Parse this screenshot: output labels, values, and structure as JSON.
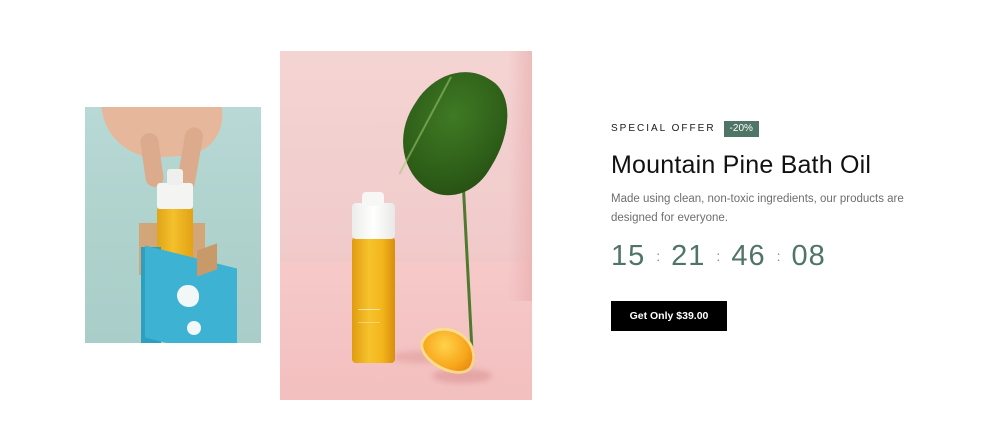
{
  "promo": {
    "offer_label": "SPECIAL OFFER",
    "discount_badge": "-20%",
    "title": "Mountain Pine Bath Oil",
    "description": "Made using clean, non-toxic ingredients, our products are designed for everyone.",
    "countdown": {
      "hours_or_days": "15",
      "hours": "21",
      "minutes": "46",
      "seconds": "08",
      "separator": ":"
    },
    "cta_label": "Get Only $39.00"
  },
  "images": {
    "secondary": "product-photo-hand-bottle-box",
    "primary": "product-photo-bottle-leaf-orange"
  },
  "colors": {
    "accent": "#4f7566",
    "button_bg": "#000000",
    "button_text": "#ffffff",
    "title_text": "#111111",
    "body_text": "#6e6e6e"
  }
}
